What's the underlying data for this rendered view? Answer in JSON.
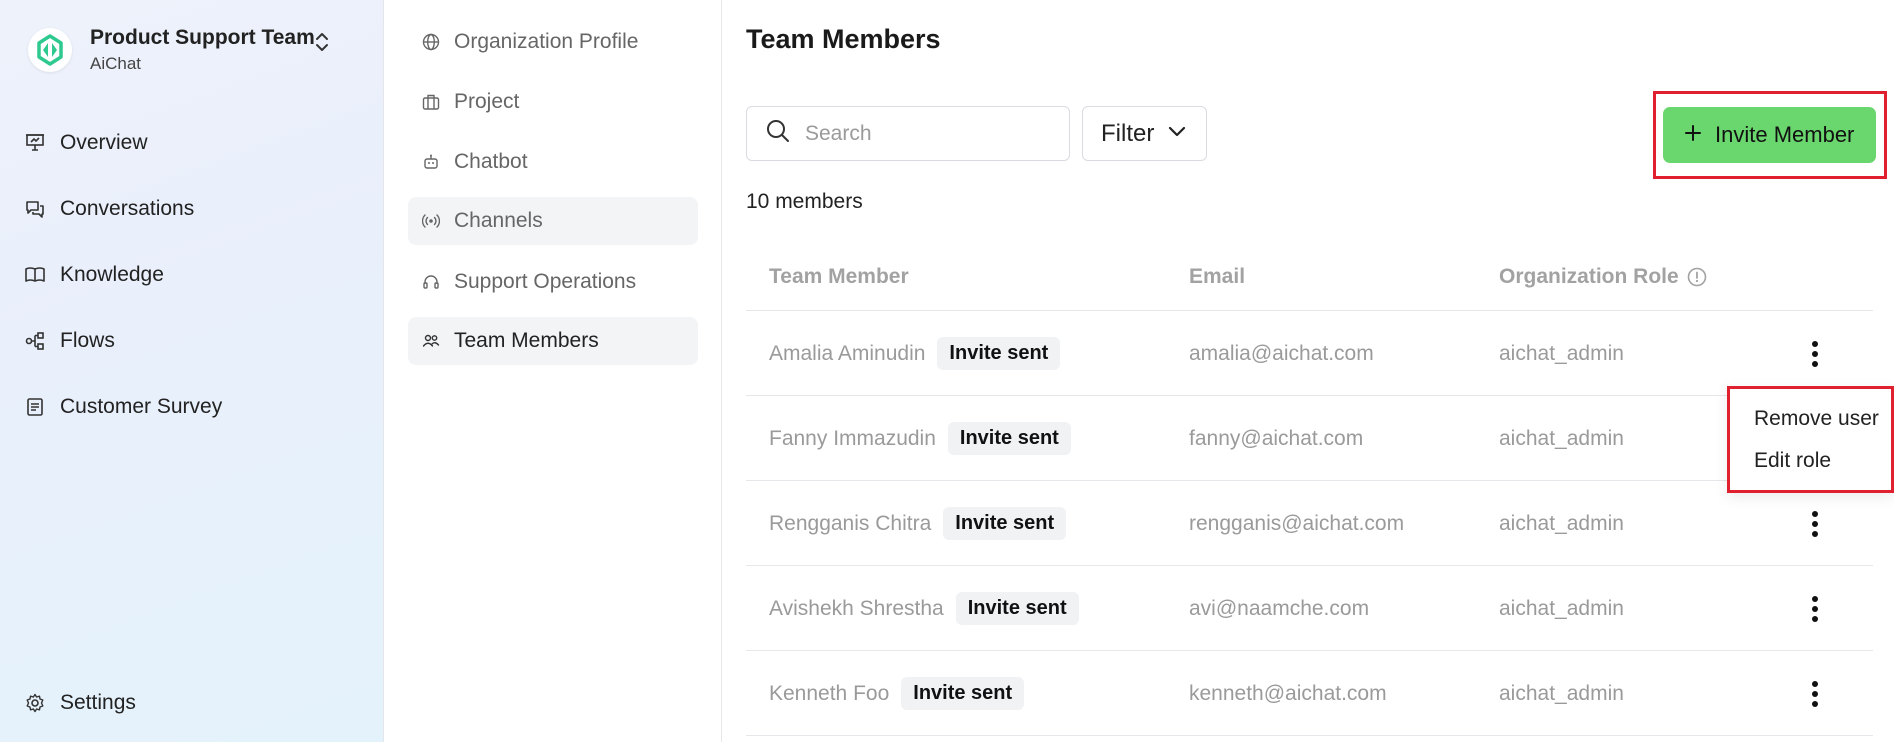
{
  "team": {
    "name": "Product Support Team",
    "org": "AiChat"
  },
  "colors": {
    "accent_green": "#6ad66e",
    "highlight_red": "#e0202e",
    "logo_green": "#2ec98e"
  },
  "sidebar": {
    "items": [
      {
        "label": "Overview",
        "icon": "presentation-icon"
      },
      {
        "label": "Conversations",
        "icon": "chat-bubbles-icon"
      },
      {
        "label": "Knowledge",
        "icon": "book-icon"
      },
      {
        "label": "Flows",
        "icon": "flow-icon"
      },
      {
        "label": "Customer Survey",
        "icon": "survey-icon"
      }
    ],
    "settings_label": "Settings"
  },
  "subnav": {
    "items": [
      {
        "label": "Organization Profile",
        "icon": "globe-icon"
      },
      {
        "label": "Project",
        "icon": "briefcase-icon"
      },
      {
        "label": "Chatbot",
        "icon": "robot-icon"
      },
      {
        "label": "Channels",
        "icon": "broadcast-icon"
      },
      {
        "label": "Support Operations",
        "icon": "headset-icon"
      },
      {
        "label": "Team Members",
        "icon": "users-icon"
      }
    ]
  },
  "main": {
    "title": "Team Members",
    "search_placeholder": "Search",
    "filter_label": "Filter",
    "invite_label": "Invite Member",
    "members_count": "10 members",
    "table": {
      "headers": [
        "Team Member",
        "Email",
        "Organization Role"
      ],
      "rows": [
        {
          "name": "Amalia Aminudin",
          "status": "Invite sent",
          "email": "amalia@aichat.com",
          "role": "aichat_admin"
        },
        {
          "name": "Fanny Immazudin",
          "status": "Invite sent",
          "email": "fanny@aichat.com",
          "role": "aichat_admin"
        },
        {
          "name": "Rengganis Chitra",
          "status": "Invite sent",
          "email": "rengganis@aichat.com",
          "role": "aichat_admin"
        },
        {
          "name": "Avishekh Shrestha",
          "status": "Invite sent",
          "email": "avi@naamche.com",
          "role": "aichat_admin"
        },
        {
          "name": "Kenneth Foo",
          "status": "Invite sent",
          "email": "kenneth@aichat.com",
          "role": "aichat_admin"
        }
      ]
    },
    "row_menu": {
      "remove_label": "Remove user",
      "edit_label": "Edit role"
    }
  }
}
